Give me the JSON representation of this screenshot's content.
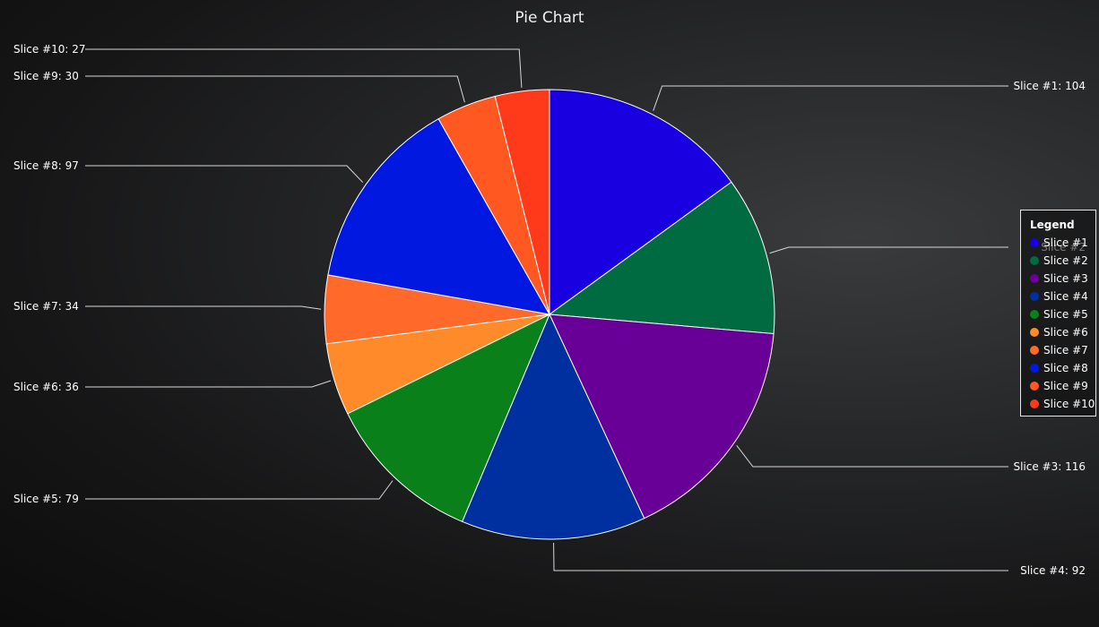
{
  "chart_data": {
    "type": "pie",
    "title": "Pie Chart",
    "legend_title": "Legend",
    "legend_position": "right",
    "start_angle": "top",
    "direction": "clockwise",
    "slices": [
      {
        "name": "Slice #1",
        "label": "Slice #1: 104",
        "value": 104,
        "color": "#1800e0"
      },
      {
        "name": "Slice #2",
        "label": "Slice #2",
        "value": 79,
        "color": "#006a40"
      },
      {
        "name": "Slice #3",
        "label": "Slice #3: 116",
        "value": 116,
        "color": "#680098"
      },
      {
        "name": "Slice #4",
        "label": "Slice #4: 92",
        "value": 92,
        "color": "#0030a0"
      },
      {
        "name": "Slice #5",
        "label": "Slice #5: 79",
        "value": 79,
        "color": "#0a801a"
      },
      {
        "name": "Slice #6",
        "label": "Slice #6: 36",
        "value": 36,
        "color": "#ff8a2a"
      },
      {
        "name": "Slice #7",
        "label": "Slice #7: 34",
        "value": 34,
        "color": "#ff6a2a"
      },
      {
        "name": "Slice #8",
        "label": "Slice #8: 97",
        "value": 97,
        "color": "#0018e0"
      },
      {
        "name": "Slice #9",
        "label": "Slice #9: 30",
        "value": 30,
        "color": "#ff5820"
      },
      {
        "name": "Slice #10",
        "label": "Slice #10: 27",
        "value": 27,
        "color": "#ff3a1a"
      }
    ]
  }
}
